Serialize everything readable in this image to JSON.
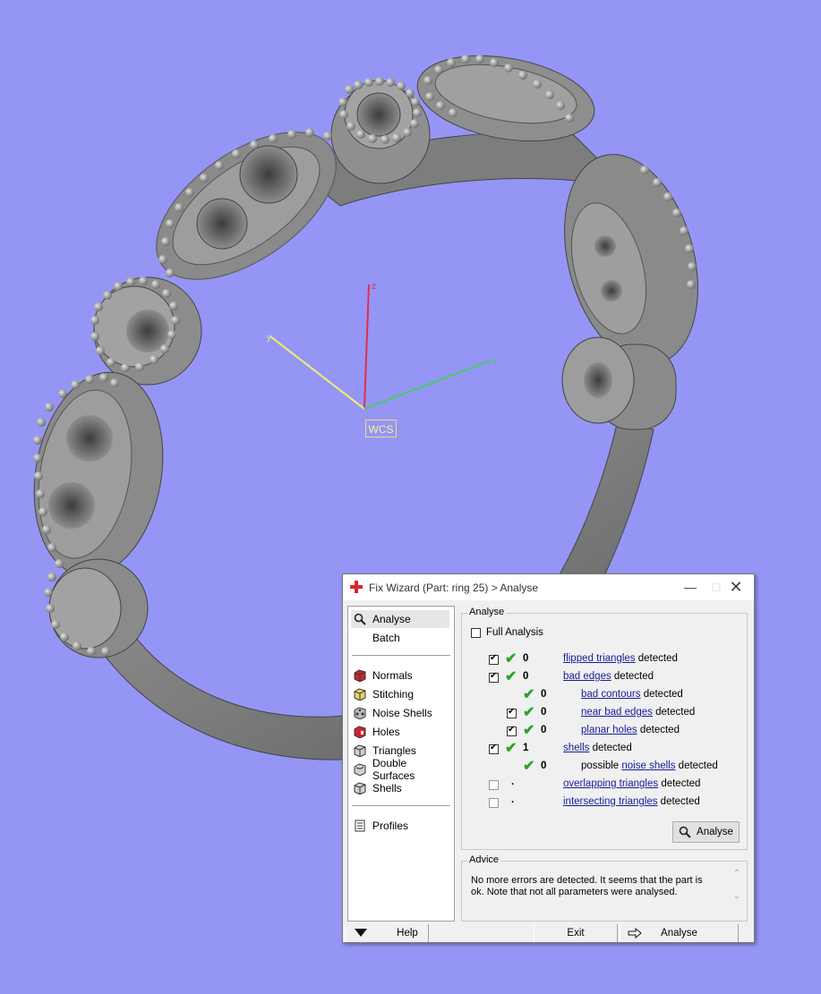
{
  "viewport": {
    "background": "#9595f5",
    "axes": {
      "z_label": "z",
      "y_label": "y",
      "x_label": "x",
      "wcs_label": "WCS"
    }
  },
  "dialog": {
    "title": "Fix Wizard (Part: ring 25) > Analyse",
    "sidebar": {
      "items": [
        {
          "label": "Analyse",
          "icon": "search-icon"
        },
        {
          "label": "Batch",
          "icon": "none"
        },
        {
          "label": "Normals",
          "icon": "cube-red-icon"
        },
        {
          "label": "Stitching",
          "icon": "cube-yellow-icon"
        },
        {
          "label": "Noise Shells",
          "icon": "noise-shells-icon"
        },
        {
          "label": "Holes",
          "icon": "cube-red-hole-icon"
        },
        {
          "label": "Triangles",
          "icon": "cube-grey-icon"
        },
        {
          "label": "Double Surfaces",
          "icon": "double-surfaces-icon"
        },
        {
          "label": "Shells",
          "icon": "cube-grey-icon"
        },
        {
          "label": "Profiles",
          "icon": "document-icon"
        }
      ]
    },
    "analyse_group": {
      "title": "Analyse",
      "full_analysis": "Full Analysis",
      "rows": [
        {
          "count": "0",
          "link": "flipped triangles",
          "suffix": " detected"
        },
        {
          "count": "0",
          "link": "bad edges",
          "suffix": " detected"
        },
        {
          "count": "0",
          "link": "bad contours",
          "suffix": " detected"
        },
        {
          "count": "0",
          "link": "near bad edges",
          "suffix": " detected"
        },
        {
          "count": "0",
          "link": "planar holes",
          "suffix": " detected"
        },
        {
          "count": "1",
          "link": "shells",
          "suffix": " detected"
        },
        {
          "count": "0",
          "prefix": "possible ",
          "link": "noise shells",
          "suffix": " detected"
        },
        {
          "count": ".",
          "link": "overlapping triangles",
          "suffix": " detected"
        },
        {
          "count": ".",
          "link": "intersecting triangles",
          "suffix": " detected"
        }
      ],
      "analyse_button": "Analyse"
    },
    "advice_group": {
      "title": "Advice",
      "text": "No more errors are detected. It seems that the part is ok. Note that not all parameters were analysed."
    },
    "bottom": {
      "help": "Help",
      "exit": "Exit",
      "analyse": "Analyse"
    }
  }
}
